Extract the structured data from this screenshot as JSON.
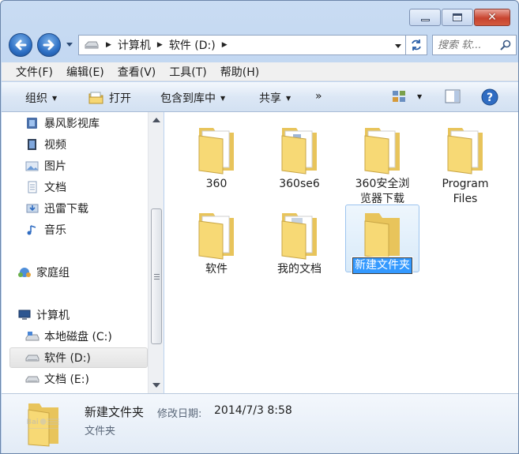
{
  "window": {
    "caption": {
      "minimize": "minimize",
      "maximize": "maximize",
      "close": "close"
    }
  },
  "nav": {
    "back_icon": "back-arrow-icon",
    "forward_icon": "forward-arrow-icon",
    "address": {
      "crumbs": [
        "计算机",
        "软件 (D:)"
      ]
    },
    "search": {
      "placeholder": "搜索 软..."
    }
  },
  "menubar": {
    "items": [
      "文件(F)",
      "编辑(E)",
      "查看(V)",
      "工具(T)",
      "帮助(H)"
    ]
  },
  "commandbar": {
    "organize": "组织",
    "open": "打开",
    "include_in_library": "包含到库中",
    "share": "共享",
    "more": "»"
  },
  "sidebar": {
    "items": [
      {
        "label": "暴风影视库",
        "icon": "video-library-icon"
      },
      {
        "label": "视频",
        "icon": "video-icon"
      },
      {
        "label": "图片",
        "icon": "pictures-icon"
      },
      {
        "label": "文档",
        "icon": "documents-icon"
      },
      {
        "label": "迅雷下载",
        "icon": "download-icon"
      },
      {
        "label": "音乐",
        "icon": "music-icon"
      },
      {
        "label": "家庭组",
        "icon": "homegroup-icon"
      },
      {
        "label": "计算机",
        "icon": "computer-icon"
      },
      {
        "label": "本地磁盘 (C:)",
        "icon": "system-drive-icon"
      },
      {
        "label": "软件 (D:)",
        "icon": "drive-icon",
        "selected": true
      },
      {
        "label": "文档 (E:)",
        "icon": "drive-icon"
      }
    ]
  },
  "content": {
    "items": [
      {
        "name": "360",
        "icon": "folder-icon"
      },
      {
        "name": "360se6",
        "icon": "folder-icon"
      },
      {
        "name": "360安全浏览器下载",
        "line1": "360安全浏",
        "line2": "览器下载",
        "icon": "folder-icon"
      },
      {
        "name": "Program Files",
        "line1": "Program",
        "line2": "Files",
        "icon": "folder-icon"
      },
      {
        "name": "软件",
        "icon": "folder-icon"
      },
      {
        "name": "我的文档",
        "icon": "folder-icon"
      },
      {
        "name": "新建文件夹",
        "icon": "folder-icon",
        "selected": true,
        "renaming": true
      }
    ]
  },
  "details": {
    "name": "新建文件夹",
    "modified_label": "修改日期:",
    "modified_value": "2014/7/3 8:58",
    "type": "文件夹"
  },
  "colors": {
    "titlebar": "#c9dcf3",
    "selection": "#3399ff",
    "folder": "#f5d66f",
    "close_button": "#c8442f"
  }
}
